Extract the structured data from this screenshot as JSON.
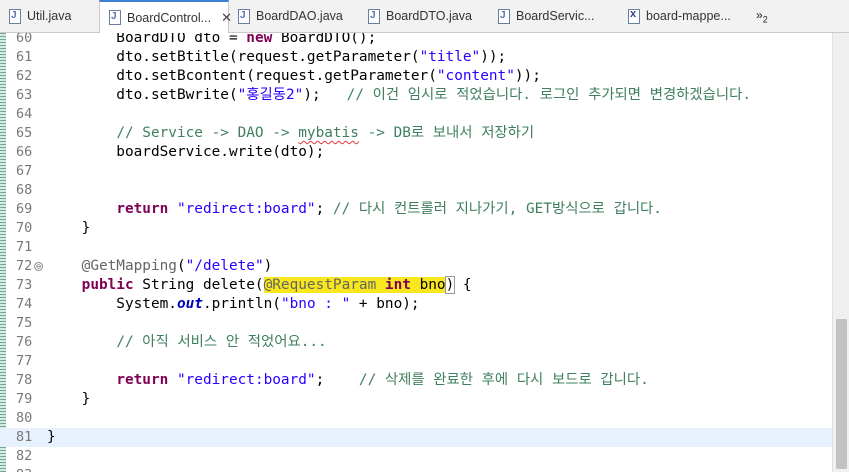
{
  "tabs": [
    {
      "label": "Util.java",
      "icon": "java-file-icon",
      "active": false
    },
    {
      "label": "BoardControl...",
      "icon": "java-file-icon",
      "active": true,
      "close": "✕"
    },
    {
      "label": "BoardDAO.java",
      "icon": "java-file-icon",
      "active": false
    },
    {
      "label": "BoardDTO.java",
      "icon": "java-file-icon",
      "active": false
    },
    {
      "label": "BoardServic...",
      "icon": "java-file-icon",
      "active": false
    },
    {
      "label": "board-mappe...",
      "icon": "xml-file-icon",
      "active": false
    }
  ],
  "tab_overflow": {
    "label": "»",
    "count": "2"
  },
  "editor": {
    "current_line": "81",
    "lines": [
      {
        "n": "60",
        "parts": [
          [
            "        BoardDTO dto = ",
            ""
          ],
          [
            "new",
            "kw"
          ],
          [
            " BoardDTO();",
            ""
          ]
        ]
      },
      {
        "n": "61",
        "parts": [
          [
            "        dto.setBtitle(request.getParameter(",
            ""
          ],
          [
            "\"title\"",
            "str"
          ],
          [
            "));",
            ""
          ]
        ]
      },
      {
        "n": "62",
        "parts": [
          [
            "        dto.setBcontent(request.getParameter(",
            ""
          ],
          [
            "\"content\"",
            "str"
          ],
          [
            "));",
            ""
          ]
        ]
      },
      {
        "n": "63",
        "parts": [
          [
            "        dto.setBwrite(",
            ""
          ],
          [
            "\"홍길동2\"",
            "str"
          ],
          [
            ");   ",
            ""
          ],
          [
            "// 이건 임시로 적었습니다. 로그인 추가되면 변경하겠습니다.",
            "cmt"
          ]
        ]
      },
      {
        "n": "64",
        "parts": []
      },
      {
        "n": "65",
        "parts": [
          [
            "        ",
            ""
          ],
          [
            "// Service -> DAO -> ",
            "cmt"
          ],
          [
            "mybatis",
            "cmt squig"
          ],
          [
            " -> DB로 보내서 저장하기",
            "cmt"
          ]
        ]
      },
      {
        "n": "66",
        "parts": [
          [
            "        boardService.write(dto);",
            ""
          ]
        ]
      },
      {
        "n": "67",
        "parts": []
      },
      {
        "n": "68",
        "parts": []
      },
      {
        "n": "69",
        "parts": [
          [
            "        ",
            ""
          ],
          [
            "return",
            "kw"
          ],
          [
            " ",
            ""
          ],
          [
            "\"redirect:board\"",
            "str"
          ],
          [
            "; ",
            ""
          ],
          [
            "// 다시 컨트롤러 지나가기, GET방식으로 갑니다.",
            "cmt"
          ]
        ]
      },
      {
        "n": "70",
        "parts": [
          [
            "    }",
            ""
          ]
        ]
      },
      {
        "n": "71",
        "parts": []
      },
      {
        "n": "72",
        "parts": [
          [
            "    ",
            ""
          ],
          [
            "@GetMapping",
            "ann"
          ],
          [
            "(",
            ""
          ],
          [
            "\"/delete\"",
            "str"
          ],
          [
            ")",
            ""
          ]
        ],
        "fold": "⊖"
      },
      {
        "n": "73",
        "parts": [
          [
            "    ",
            ""
          ],
          [
            "public",
            "kw"
          ],
          [
            " String delete(",
            ""
          ],
          [
            "@RequestParam ",
            "ann hl"
          ],
          [
            "int",
            "kw hl"
          ],
          [
            " bno",
            "hl"
          ],
          [
            ")",
            "box"
          ],
          [
            " {",
            ""
          ]
        ]
      },
      {
        "n": "74",
        "parts": [
          [
            "        System.",
            ""
          ],
          [
            "out",
            "ital"
          ],
          [
            ".println(",
            ""
          ],
          [
            "\"bno : \"",
            "str"
          ],
          [
            " + bno);",
            ""
          ]
        ]
      },
      {
        "n": "75",
        "parts": []
      },
      {
        "n": "76",
        "parts": [
          [
            "        ",
            ""
          ],
          [
            "// 아직 서비스 안 적었어요...",
            "cmt"
          ]
        ]
      },
      {
        "n": "77",
        "parts": []
      },
      {
        "n": "78",
        "parts": [
          [
            "        ",
            ""
          ],
          [
            "return",
            "kw"
          ],
          [
            " ",
            ""
          ],
          [
            "\"redirect:board\"",
            "str"
          ],
          [
            ";    ",
            ""
          ],
          [
            "// 삭제를 완료한 후에 다시 보드로 갑니다.",
            "cmt"
          ]
        ]
      },
      {
        "n": "79",
        "parts": [
          [
            "    }",
            ""
          ]
        ]
      },
      {
        "n": "80",
        "parts": []
      },
      {
        "n": "81",
        "parts": [
          [
            "}",
            ""
          ]
        ]
      },
      {
        "n": "82",
        "parts": []
      },
      {
        "n": "83",
        "parts": []
      }
    ]
  },
  "colors": {
    "keyword": "#7f0055",
    "string": "#2a00ff",
    "comment": "#3f7f5f",
    "highlight": "#f8e71c"
  }
}
